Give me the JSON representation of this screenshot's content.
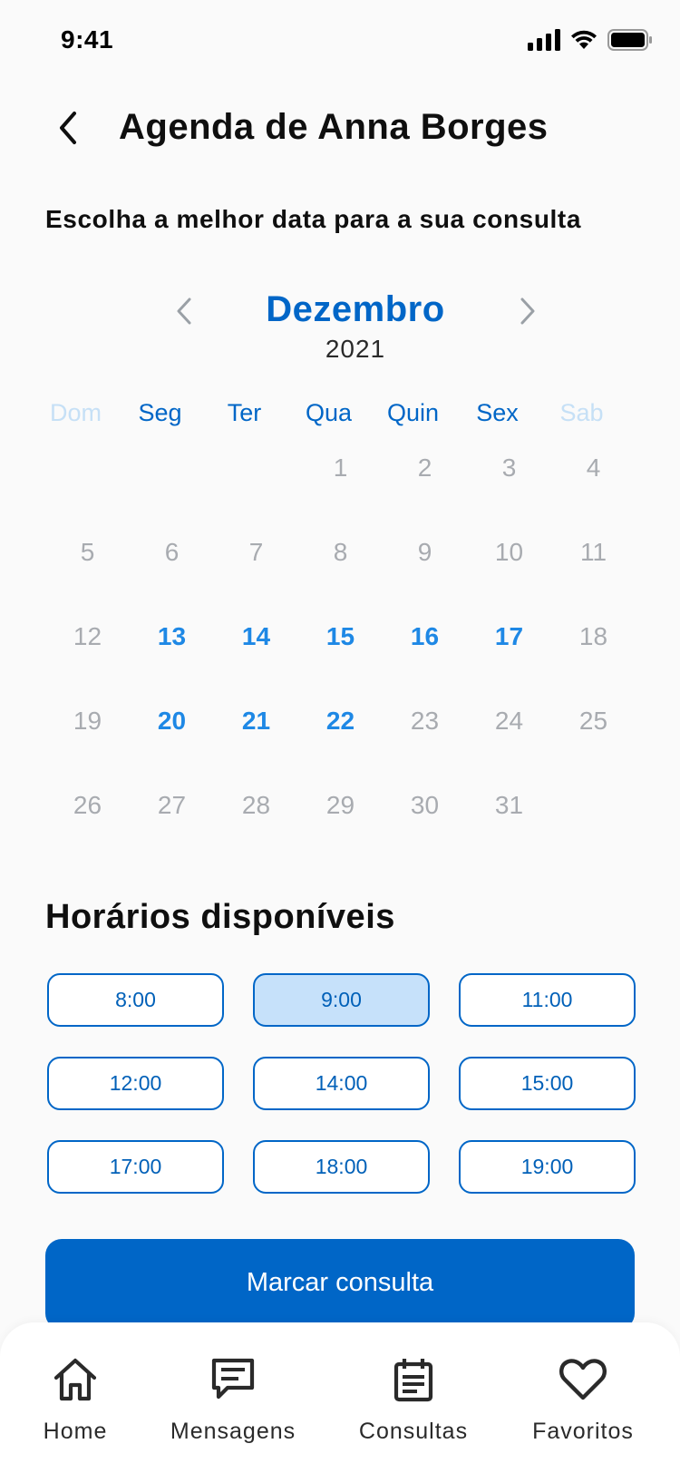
{
  "status_bar": {
    "time": "9:41"
  },
  "header": {
    "title": "Agenda de Anna Borges"
  },
  "subtitle": "Escolha a melhor data para a sua consulta",
  "calendar": {
    "month": "Dezembro",
    "year": "2021",
    "weekdays": [
      "Dom",
      "Seg",
      "Ter",
      "Qua",
      "Quin",
      "Sex",
      "Sab"
    ],
    "leading_blanks": 3,
    "days": [
      {
        "d": "1",
        "available": false
      },
      {
        "d": "2",
        "available": false
      },
      {
        "d": "3",
        "available": false
      },
      {
        "d": "4",
        "available": false
      },
      {
        "d": "5",
        "available": false
      },
      {
        "d": "6",
        "available": false
      },
      {
        "d": "7",
        "available": false
      },
      {
        "d": "8",
        "available": false
      },
      {
        "d": "9",
        "available": false
      },
      {
        "d": "10",
        "available": false
      },
      {
        "d": "11",
        "available": false
      },
      {
        "d": "12",
        "available": false
      },
      {
        "d": "13",
        "available": true
      },
      {
        "d": "14",
        "available": true
      },
      {
        "d": "15",
        "available": true
      },
      {
        "d": "16",
        "available": true
      },
      {
        "d": "17",
        "available": true
      },
      {
        "d": "18",
        "available": false
      },
      {
        "d": "19",
        "available": false
      },
      {
        "d": "20",
        "available": true
      },
      {
        "d": "21",
        "available": true
      },
      {
        "d": "22",
        "available": true
      },
      {
        "d": "23",
        "available": false
      },
      {
        "d": "24",
        "available": false
      },
      {
        "d": "25",
        "available": false
      },
      {
        "d": "26",
        "available": false
      },
      {
        "d": "27",
        "available": false
      },
      {
        "d": "28",
        "available": false
      },
      {
        "d": "29",
        "available": false
      },
      {
        "d": "30",
        "available": false
      },
      {
        "d": "31",
        "available": false
      }
    ]
  },
  "times": {
    "title": "Horários disponíveis",
    "slots": [
      {
        "label": "8:00",
        "selected": false
      },
      {
        "label": "9:00",
        "selected": true
      },
      {
        "label": "11:00",
        "selected": false
      },
      {
        "label": "12:00",
        "selected": false
      },
      {
        "label": "14:00",
        "selected": false
      },
      {
        "label": "15:00",
        "selected": false
      },
      {
        "label": "17:00",
        "selected": false
      },
      {
        "label": "18:00",
        "selected": false
      },
      {
        "label": "19:00",
        "selected": false
      }
    ]
  },
  "book_button": "Marcar consulta",
  "bottom_nav": {
    "items": [
      {
        "label": "Home",
        "icon": "home-icon"
      },
      {
        "label": "Mensagens",
        "icon": "message-icon"
      },
      {
        "label": "Consultas",
        "icon": "calendar-icon"
      },
      {
        "label": "Favoritos",
        "icon": "heart-icon"
      }
    ]
  },
  "colors": {
    "primary": "#0066C7",
    "available_day": "#1E88E5",
    "unavailable_day": "#A8ABB0",
    "weekend_header": "#C6E0F6",
    "selected_slot_bg": "#C6E1FA",
    "background": "#FAFAFA"
  }
}
